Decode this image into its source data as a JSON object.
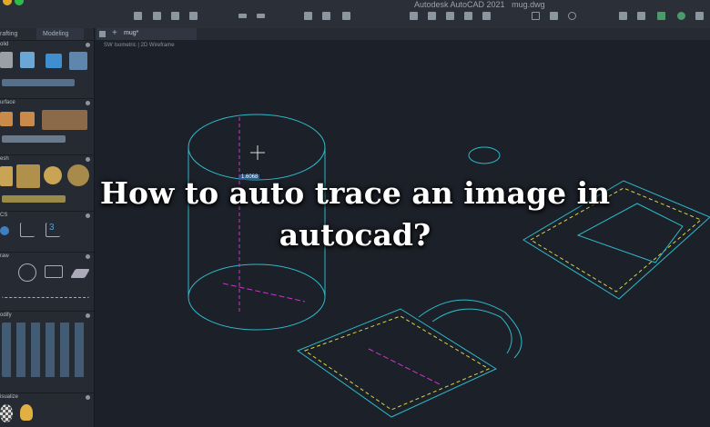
{
  "window": {
    "app_title": "Autodesk AutoCAD 2021",
    "file_name": "mug.dwg"
  },
  "workspace_tabs": [
    "rafting",
    "Modeling"
  ],
  "document_tab": "mug*",
  "viewport_label": "SW Isometric | 2D Wireframe",
  "palette_sections": [
    "olid",
    "urface",
    "esh",
    "CS",
    "raw",
    "odify",
    "isualize"
  ],
  "dimension_value": "1.6068",
  "headline": "How to auto trace an image in autocad?",
  "colors": {
    "wire": "#2fb8c8",
    "accent": "#d6d64a",
    "hidden": "#c43cc4"
  }
}
